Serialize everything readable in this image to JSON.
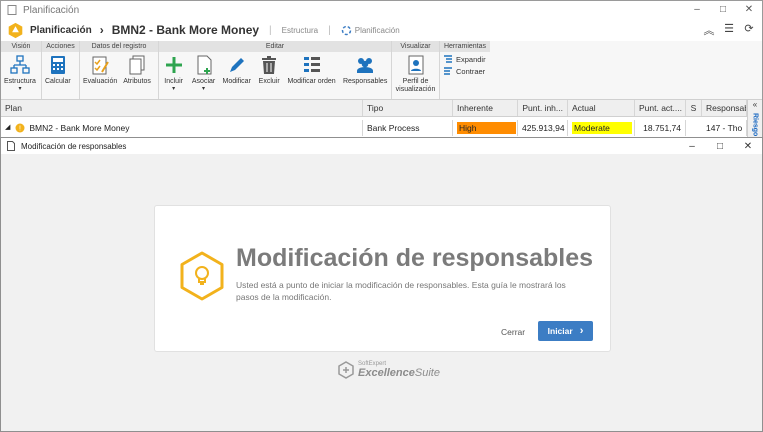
{
  "window": {
    "title": "Planificación",
    "controls": [
      "–",
      "□",
      "✕"
    ]
  },
  "header": {
    "app_name": "Planificación",
    "separator": "›",
    "record_title": "BMN2 - Bank More Money",
    "link_estructura": "Estructura",
    "link_planificacion": "Planificación"
  },
  "ribbon": {
    "groups": {
      "vision": "Visión",
      "acciones": "Acciones",
      "datos": "Datos del registro",
      "editar": "Editar",
      "visualizar": "Visualizar",
      "herramientas": "Herramientas"
    },
    "buttons": {
      "estructura": "Estructura",
      "calcular": "Calcular",
      "evaluacion": "Evaluación",
      "atributos": "Atributos",
      "incluir": "Incluir",
      "asociar": "Asociar",
      "modificar": "Modificar",
      "excluir": "Excluir",
      "modificar_orden": "Modificar orden",
      "responsables": "Responsables",
      "perfil": "Perfil de visualización",
      "expandir": "Expandir",
      "contraer": "Contraer"
    }
  },
  "grid": {
    "columns": [
      "Plan",
      "Tipo",
      "Inherente",
      "Punt. inh...",
      "Actual",
      "Punt. act....",
      "S",
      "Responsab"
    ],
    "rows": [
      {
        "plan": "BMN2 - Bank More Money",
        "tipo": "Bank Process",
        "inherente": "High",
        "punt_inh": "425.913,94",
        "actual": "Moderate",
        "punt_act": "18.751,74",
        "s": "",
        "responsable": "147 - Tho"
      }
    ],
    "side_panel_label": "Riesgo"
  },
  "colors": {
    "high": "#ff8c00",
    "moderate": "#ffff00",
    "accent": "#3c7dc4",
    "hex_icon": "#f2b21c"
  },
  "modal": {
    "title": "Modificación de responsables",
    "card_title": "Modificación de responsables",
    "card_description": "Usted está a punto de iniciar la modificación de responsables. Esta guía le mostrará los pasos de la modificación.",
    "close_button": "Cerrar",
    "start_button": "Iniciar",
    "brand_small": "SoftExpert",
    "brand_big": "Excellence",
    "brand_suffix": "Suite"
  }
}
